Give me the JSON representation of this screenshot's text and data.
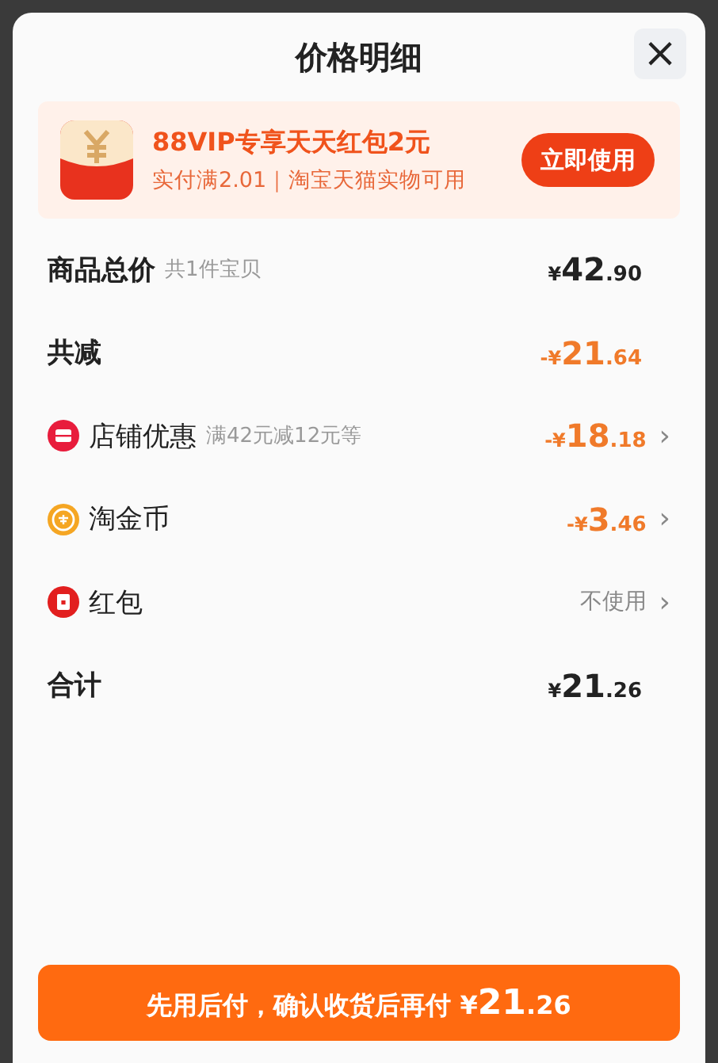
{
  "title": "价格明细",
  "close": "×",
  "promo": {
    "headline": "88VIP专享天天红包2元",
    "detail": "实付满2.01｜淘宝天猫实物可用",
    "button": "立即使用"
  },
  "rows": [
    {
      "kind": "plain",
      "label": "商品总价",
      "note": "共1件宝贝",
      "amount": {
        "sign": "¥",
        "integer": "42",
        "fraction": ".90"
      },
      "color": "#222222"
    },
    {
      "kind": "plain",
      "label": "共减",
      "amount": {
        "sign": "-¥",
        "integer": "21",
        "fraction": ".64"
      },
      "color": "#f07a2a"
    },
    {
      "kind": "store",
      "label": "店铺优惠",
      "note": "满42元减12元等",
      "amount": {
        "sign": "-¥",
        "integer": "18",
        "fraction": ".18"
      },
      "color": "#f07a2a",
      "arrow": "›"
    },
    {
      "kind": "coin",
      "label": "淘金币",
      "amount": {
        "sign": "-¥",
        "integer": "3",
        "fraction": ".46"
      },
      "color": "#f07a2a",
      "arrow": "›"
    },
    {
      "kind": "packet",
      "label": "红包",
      "status": "不使用",
      "arrow": "›"
    },
    {
      "kind": "plain",
      "label": "合计",
      "amount": {
        "sign": "¥",
        "integer": "21",
        "fraction": ".26"
      },
      "color": "#222222"
    }
  ],
  "pay_button": {
    "text": "先用后付，确认收货后再付",
    "amount": {
      "sign": "¥",
      "integer": "21",
      "fraction": ".26"
    }
  }
}
